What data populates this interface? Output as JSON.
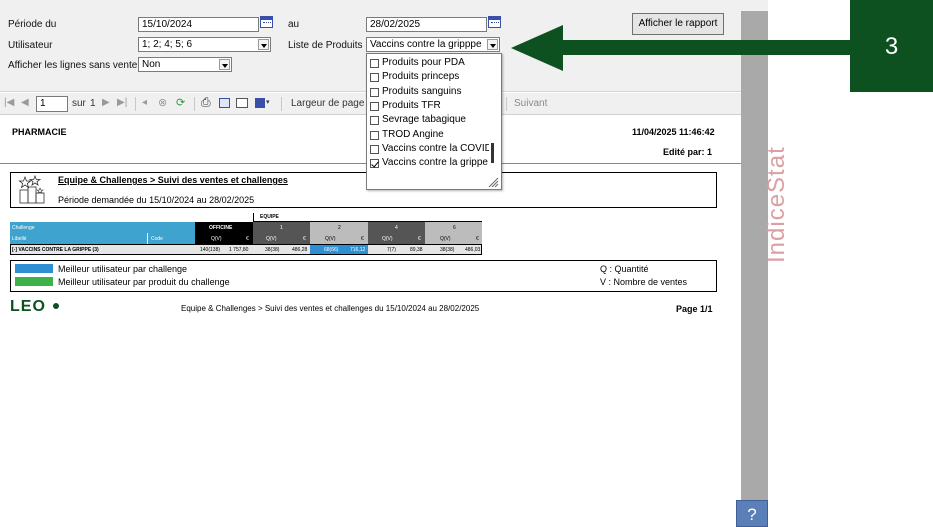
{
  "params": {
    "periode_label": "Période du",
    "date_from": "15/10/2024",
    "au_label": "au",
    "date_to": "28/02/2025",
    "utilisateur_label": "Utilisateur",
    "utilisateur_value": "1; 2; 4; 5; 6",
    "liste_label": "Liste de Produits",
    "liste_value": "Vaccins contre la gripppe",
    "sans_vente_label": "Afficher les lignes sans vente",
    "sans_vente_value": "Non",
    "afficher_button": "Afficher le rapport"
  },
  "dropdown": {
    "items": [
      {
        "label": "Produits pour PDA",
        "checked": false
      },
      {
        "label": "Produits princeps",
        "checked": false
      },
      {
        "label": "Produits sanguins",
        "checked": false
      },
      {
        "label": "Produits TFR",
        "checked": false
      },
      {
        "label": "Sevrage tabagique",
        "checked": false
      },
      {
        "label": "TROD Angine",
        "checked": false
      },
      {
        "label": "Vaccins contre la COVID-",
        "checked": false
      },
      {
        "label": "Vaccins contre la grippe",
        "checked": true
      }
    ]
  },
  "toolbar": {
    "page_value": "1",
    "sur_label": "sur",
    "total_pages": "1",
    "zoom_label": "Largeur de page",
    "suivant_label": "Suivant"
  },
  "report": {
    "pharmacy": "PHARMACIE",
    "datetime": "11/04/2025 11:46:42",
    "edited_by": "Edité par: 1",
    "title": "Equipe & Challenges > Suivi des ventes et challenges",
    "period": "Période demandée du 15/10/2024 au 28/02/2025",
    "table": {
      "equipe_label": "EQUIPE",
      "challenge_label": "Challenge",
      "libelle_label": "Libellé",
      "code_label": "Code",
      "officine_label": "OFFICINE",
      "cols": [
        "1",
        "2",
        "4",
        "6"
      ],
      "qv_label": "Q(V)",
      "euro_label": "€",
      "row_label": "[-] VACCINS CONTRE LA GRIPPE (3)",
      "row_values": [
        "140(138)",
        "1 757,80",
        "38(38)",
        "486,28",
        "68(66)",
        "716,12",
        "7(7)",
        "89,38",
        "38(38)",
        "486,03"
      ]
    },
    "legend": {
      "best_user": "Meilleur utilisateur par challenge",
      "best_user_product": "Meilleur utilisateur par produit du challenge",
      "q_label": "Q : Quantité",
      "v_label": "V : Nombre de ventes",
      "best_user_color": "#2f8fd3",
      "best_user_product_color": "#3cb34a"
    },
    "footer_logo": "LEO",
    "footer_text": "Equipe & Challenges > Suivi des ventes et challenges du 15/10/2024 au 28/02/2025",
    "page_label": "Page 1/1"
  },
  "side": {
    "brand": "IndiceStat",
    "help": "?"
  },
  "callout": {
    "step": "3",
    "color": "#0d5121"
  }
}
